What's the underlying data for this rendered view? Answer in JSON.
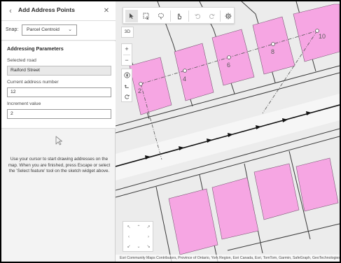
{
  "panel": {
    "title": "Add Address Points",
    "back_icon": "chevron-left-icon",
    "close_icon": "close-icon"
  },
  "snap": {
    "label": "Snap:",
    "selected": "Parcel Centroid"
  },
  "params": {
    "section_title": "Addressing Parameters",
    "road_label": "Selected road",
    "road_value": "Raiford Street",
    "address_label": "Current address number",
    "address_value": "12",
    "increment_label": "Increment value",
    "increment_value": "2"
  },
  "instructions": "Use your cursor to start drawing addresses on the map. When you are finished, press Escape or select the 'Select feature' tool on the sketch widget above.",
  "map": {
    "btn_3d": "3D",
    "zoom_in": "+",
    "zoom_out": "−",
    "point_labels": [
      "2",
      "4",
      "6",
      "8",
      "10"
    ],
    "attribution": "Esri Community Maps Contributors, Province of Ontario, York Region, Esri Canada, Esri, TomTom, Garmin, SafeGraph, GeoTechnologies"
  },
  "colors": {
    "parcel_fill": "#f6a6e3",
    "parcel_stroke": "#4a4a4a",
    "road_line": "#111111",
    "map_bg": "#ececec",
    "panel_bg": "#f3f3f3"
  }
}
